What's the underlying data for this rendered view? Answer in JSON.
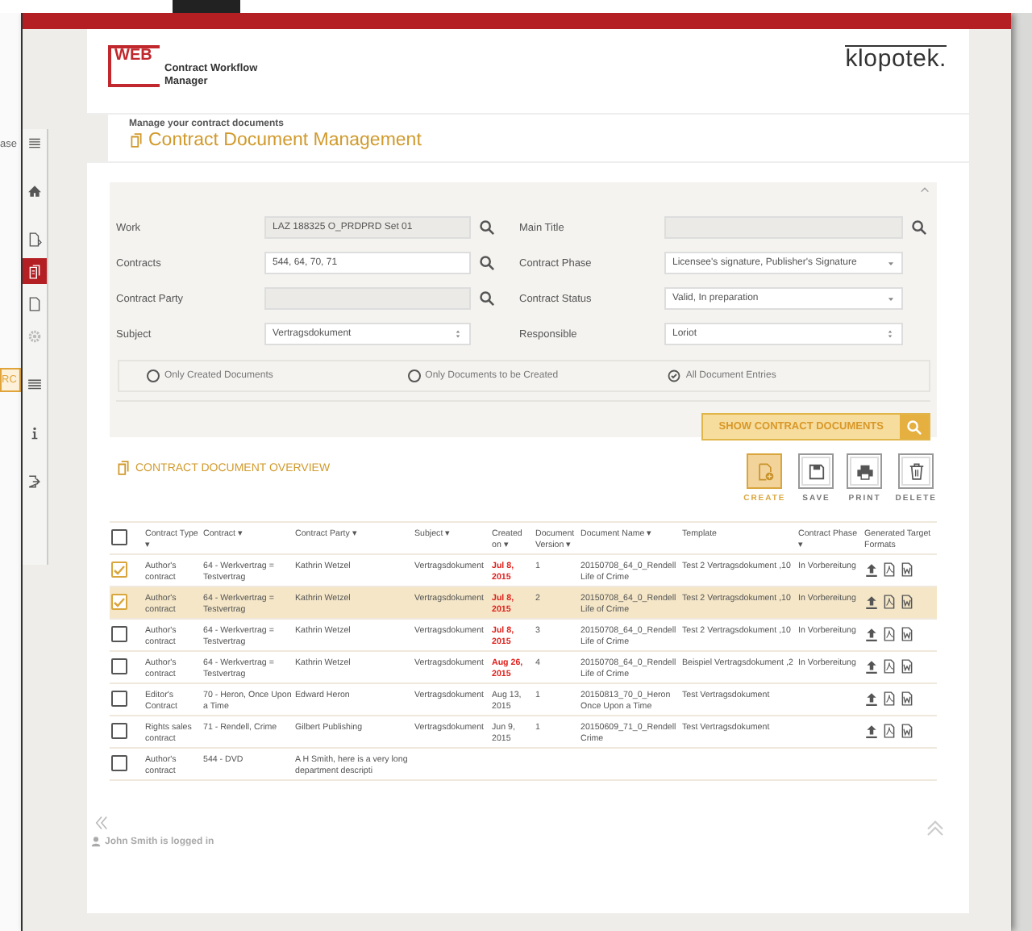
{
  "background": {
    "fragments": [
      "ase",
      "RC"
    ]
  },
  "sidebar": {
    "items": [
      {
        "kind": "menu",
        "selected": false
      },
      {
        "kind": "home",
        "selected": false
      },
      {
        "kind": "document-arrow",
        "selected": false
      },
      {
        "kind": "documents",
        "selected": true
      },
      {
        "kind": "document",
        "selected": false
      },
      {
        "kind": "gear",
        "selected": false
      },
      {
        "kind": "list",
        "selected": false
      },
      {
        "kind": "info",
        "selected": false
      },
      {
        "kind": "exit",
        "selected": false
      }
    ]
  },
  "header": {
    "logo_mark": "WEB",
    "logo_text": "Contract Workflow Manager",
    "brand": "klopotek."
  },
  "page": {
    "subtitle": "Manage your contract documents",
    "title": "Contract Document Management"
  },
  "filters": {
    "left": [
      {
        "label": "Work",
        "kind": "lookup",
        "value": "LAZ 188325 O_PRDPRD Set 01",
        "disabled": true
      },
      {
        "label": "Contracts",
        "kind": "lookup",
        "value": "544, 64, 70, 71",
        "disabled": false
      },
      {
        "label": "Contract Party",
        "kind": "lookup",
        "disabled": true
      },
      {
        "label": "Subject",
        "kind": "spinner",
        "value": "Vertragsdokument",
        "disabled": false
      }
    ],
    "right": [
      {
        "label": "Main Title",
        "kind": "lookup",
        "disabled": true
      },
      {
        "label": "Contract Phase",
        "kind": "dropdown",
        "value": "Licensee's signature, Publisher's Signature",
        "disabled": false
      },
      {
        "label": "Contract Status",
        "kind": "dropdown",
        "value": "Valid, In preparation",
        "disabled": false
      },
      {
        "label": "Responsible",
        "kind": "spinner",
        "value": "Loriot",
        "disabled": false
      }
    ],
    "radios": [
      {
        "label": "Only Created Documents",
        "selected": false
      },
      {
        "label": "Only Documents to be Created",
        "selected": false
      },
      {
        "label": "All Document Entries",
        "selected": true
      }
    ],
    "search_button": "SHOW CONTRACT DOCUMENTS"
  },
  "overview": {
    "title": "CONTRACT DOCUMENT OVERVIEW",
    "actions": [
      {
        "kind": "create",
        "label": "CREATE",
        "highlighted": true
      },
      {
        "kind": "save",
        "label": "SAVE",
        "highlighted": false
      },
      {
        "kind": "print",
        "label": "PRINT",
        "highlighted": false
      },
      {
        "kind": "delete",
        "label": "DELETE",
        "highlighted": false
      }
    ]
  },
  "table": {
    "header_checked": false,
    "columns": [
      "Contract Type ▾",
      "Contract ▾",
      "Contract Party ▾",
      "Subject ▾",
      "Created on ▾",
      "Document Version ▾",
      "Document Name ▾",
      "Template",
      "Contract Phase ▾",
      "Generated Target Formats"
    ],
    "rows": [
      {
        "checked": true,
        "selected": false,
        "overdue": true,
        "formats": true,
        "cells": [
          "Author's contract",
          "64 - Werkvertrag = Testvertrag",
          "Kathrin Wetzel",
          "Vertragsdokument",
          "Jul 8, 2015",
          "1",
          "20150708_64_0_Rendell Life of Crime",
          "Test 2 Vertragsdokument ,10",
          "In Vorbereitung"
        ]
      },
      {
        "checked": true,
        "selected": true,
        "overdue": true,
        "formats": true,
        "cells": [
          "Author's contract",
          "64 - Werkvertrag = Testvertrag",
          "Kathrin Wetzel",
          "Vertragsdokument",
          "Jul 8, 2015",
          "2",
          "20150708_64_0_Rendell Life of Crime",
          "Test 2 Vertragsdokument ,10",
          "In Vorbereitung"
        ]
      },
      {
        "checked": false,
        "selected": false,
        "overdue": true,
        "formats": true,
        "cells": [
          "Author's contract",
          "64 - Werkvertrag = Testvertrag",
          "Kathrin Wetzel",
          "Vertragsdokument",
          "Jul 8, 2015",
          "3",
          "20150708_64_0_Rendell Life of Crime",
          "Test 2 Vertragsdokument ,10",
          "In Vorbereitung"
        ]
      },
      {
        "checked": false,
        "selected": false,
        "overdue": true,
        "formats": true,
        "cells": [
          "Author's contract",
          "64 - Werkvertrag = Testvertrag",
          "Kathrin Wetzel",
          "Vertragsdokument",
          "Aug 26, 2015",
          "4",
          "20150708_64_0_Rendell Life of Crime",
          "Beispiel Vertragsdokument ,2",
          "In Vorbereitung"
        ]
      },
      {
        "checked": false,
        "selected": false,
        "overdue": false,
        "formats": true,
        "cells": [
          "Editor's Contract",
          "70 - Heron, Once Upon a Time",
          "Edward Heron",
          "Vertragsdokument",
          "Aug 13, 2015",
          "1",
          "20150813_70_0_Heron Once Upon a Time",
          "Test Vertragsdokument",
          ""
        ]
      },
      {
        "checked": false,
        "selected": false,
        "overdue": false,
        "formats": true,
        "cells": [
          "Rights sales contract",
          "71 - Rendell, Crime",
          "Gilbert Publishing",
          "Vertragsdokument",
          "Jun 9, 2015",
          "1",
          "20150609_71_0_Rendell Crime",
          "Test Vertragsdokument",
          ""
        ]
      },
      {
        "checked": false,
        "selected": false,
        "formats": false,
        "cells": [
          "Author's contract",
          "544 - DVD",
          "A H Smith, here is a very long department descripti",
          "",
          "",
          "",
          "",
          "",
          ""
        ]
      }
    ]
  },
  "footer": {
    "user": "John Smith is logged in"
  }
}
